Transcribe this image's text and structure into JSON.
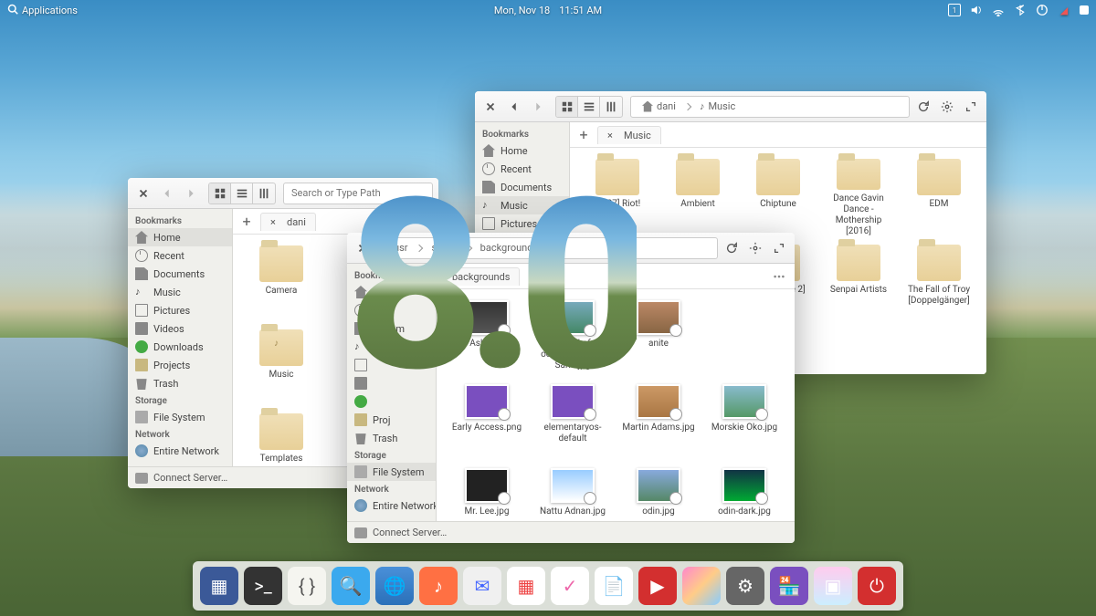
{
  "panel": {
    "applications": "Applications",
    "date": "Mon, Nov 18",
    "time": "11:51 AM"
  },
  "sidebar": {
    "bookmarks_head": "Bookmarks",
    "home": "Home",
    "recent": "Recent",
    "documents": "Documents",
    "music": "Music",
    "pictures": "Pictures",
    "videos": "Videos",
    "downloads": "Downloads",
    "projects": "Projects",
    "trash": "Trash",
    "storage_head": "Storage",
    "filesystem": "File System",
    "network_head": "Network",
    "entire_network": "Entire Network"
  },
  "connect_server": "Connect Server…",
  "win1": {
    "search_placeholder": "Search or Type Path",
    "tab": "dani",
    "items": {
      "camera": "Camera",
      "music": "Music",
      "templates": "Templates"
    }
  },
  "win2": {
    "crumbs": [
      "dani",
      "Music"
    ],
    "tab": "Music",
    "items": {
      "riot": "[2007] Riot!",
      "ambient": "Ambient",
      "chiptune": "Chiptune",
      "dgd": "Dance Gavin Dance - Mothership [2016]",
      "edm": "EDM",
      "veil": "Veil - h The 2]",
      "senpai": "Senpai Artists",
      "troy": "The Fall of Troy [Doppelgänger]"
    }
  },
  "win3": {
    "crumbs": [
      "usr",
      "share",
      "backgrounds"
    ],
    "tab": "backgrounds",
    "items": {
      "ashim": "Ashim D",
      "trail": "A Trail of ootprints In The Sand.jpg",
      "anite": "anite",
      "early": "Early Access.png",
      "eos": "elementaryos-default",
      "martin": "Martin Adams.jpg",
      "morskie": "Morskie Oko.jpg",
      "mrlee": "Mr. Lee.jpg",
      "nattu": "Nattu Adnan.jpg",
      "odin": "odin.jpg",
      "odindark": "odin-dark.jpg"
    }
  },
  "version": "8.0",
  "dock": {
    "items": [
      "files",
      "terminal",
      "code",
      "appstore",
      "web",
      "music",
      "mail",
      "calendar",
      "tasks",
      "photos",
      "videos",
      "gallery",
      "settings",
      "screenshots",
      "power"
    ]
  }
}
